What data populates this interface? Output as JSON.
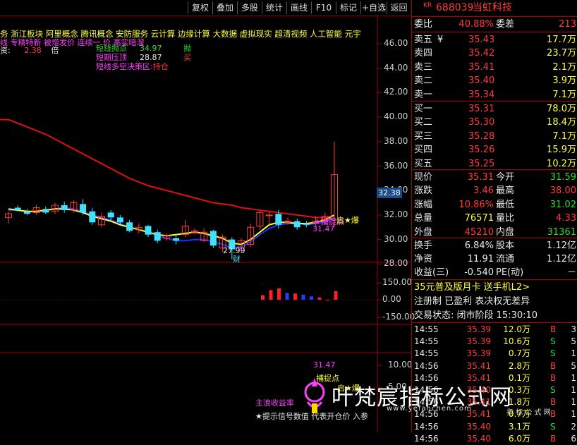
{
  "toolbar": {
    "items": [
      "复权",
      "叠加",
      "多股",
      "统计",
      "画线",
      "F10",
      "标记",
      "+自选",
      "返回"
    ]
  },
  "concepts": "务 浙江板块 阿里概念 腾讯概念 安防服务 云计算 边缘计算 大数据 虚拟现实 超清视频 人工智能 元宇",
  "overlay_lines": {
    "line1": "线 专精特新 被增发价 连续一 价 高实暗溜",
    "line2_left": "资:",
    "line2_val": "2.38",
    "line2_unit": "倍"
  },
  "strategy": {
    "rows": [
      {
        "label": "短线抛点",
        "value": "34.97",
        "signal": "抛"
      },
      {
        "label": "短期压顶",
        "value": "28.87",
        "signal": "买"
      }
    ],
    "zone_label": "短线多空决策区:",
    "zone_value": "持仓"
  },
  "price_axis": {
    "ticks": [
      "46.00",
      "44.00",
      "42.00",
      "40.00",
      "38.00",
      "36.00",
      "34.00",
      "32.00",
      "30.00",
      "28.00"
    ],
    "current": "32.38"
  },
  "volume_axis": {
    "ticks": [
      "150.00",
      "0.00",
      "-150.00"
    ]
  },
  "lower_axis": {
    "ticks": [
      "10.00",
      "5.00"
    ]
  },
  "chart_annotations": {
    "low": "27.99",
    "low_label": "财",
    "buy_label": "★捕捉点",
    "buy_value": "31.47",
    "boom_label": "启★爆",
    "lower_value": "31.47",
    "lower_buy": "捕捉点",
    "lower_boom": "启★爆"
  },
  "lower_texts": {
    "main": "主浪收益率",
    "hint": "★提示信号数值 代表开仓价 入参"
  },
  "watermark": {
    "name": "叶梵宸指标公式网",
    "url": "www.yefanchen.com",
    "url_cn": "指 标 公 式 网"
  },
  "quote": {
    "code_prefix": "KR",
    "code": "688039",
    "name": "当虹科技",
    "weibi_label": "委比",
    "weibi": "40.88%",
    "weicha_label": "委差",
    "weicha": "213",
    "sell": [
      {
        "label": "卖五",
        "mark": "¥",
        "price": "35.43",
        "vol": "17.7万"
      },
      {
        "label": "卖四",
        "price": "35.42",
        "vol": "23.7万"
      },
      {
        "label": "卖三",
        "price": "35.41",
        "vol": "2.1万"
      },
      {
        "label": "卖二",
        "price": "35.40",
        "vol": "3.9万"
      },
      {
        "label": "卖一",
        "price": "35.34",
        "vol": "7.1万"
      }
    ],
    "buy": [
      {
        "label": "买一",
        "price": "35.31",
        "vol": "78.0万"
      },
      {
        "label": "买二",
        "price": "35.30",
        "vol": "18.4万"
      },
      {
        "label": "买三",
        "price": "35.28",
        "vol": "7.1万"
      },
      {
        "label": "买四",
        "price": "35.26",
        "vol": "15.9万"
      },
      {
        "label": "买五",
        "price": "35.25",
        "vol": "10.2万"
      }
    ],
    "stats": [
      {
        "l1": "现价",
        "v1": "35.31",
        "l2": "今开",
        "v2": "31.59"
      },
      {
        "l1": "涨跌",
        "v1": "3.46",
        "l2": "最高",
        "v2": "38.00"
      },
      {
        "l1": "涨幅",
        "v1": "10.86%",
        "l2": "最低",
        "v2": "31.02"
      },
      {
        "l1": "总量",
        "v1": "76571",
        "l2": "量比",
        "v2": "4.33"
      },
      {
        "l1": "外盘",
        "v1": "45210",
        "l2": "内盘",
        "v2": "31361"
      }
    ],
    "stats2": [
      {
        "l1": "换手",
        "v1": "6.84%",
        "l2": "股本",
        "v2": "1.12亿"
      },
      {
        "l1": "净资",
        "v1": "11.91",
        "l2": "流通",
        "v2": "1.12亿"
      },
      {
        "l1": "收益(三)",
        "v1": "-0.540",
        "l2": "PE(动)",
        "v2": "－"
      }
    ],
    "promo": "35元普及版月卡 送手机L2>",
    "register": "注册制 已盈利 表决权无差异",
    "status": "交易状态: 闭市阶段 15:30:10",
    "trades": [
      {
        "t": "14:55",
        "p": "35.39",
        "v": "12.0万",
        "s": "B",
        "n": "3"
      },
      {
        "t": "14:55",
        "p": "35.39",
        "v": "10.6万",
        "s": "S",
        "n": "5"
      },
      {
        "t": "14:55",
        "p": "35.39",
        "v": "0.7万",
        "s": "S",
        "n": "1"
      },
      {
        "t": "14:56",
        "p": "35.41",
        "v": "2.8万",
        "s": "B",
        "n": "5"
      },
      {
        "t": "14:56",
        "p": "35.41",
        "v": "0.1万",
        "s": "B",
        "n": "1"
      },
      {
        "t": "14:56",
        "p": "35.40",
        "v": "0.3万",
        "s": "S",
        "n": "1"
      },
      {
        "t": "14:56",
        "p": "35.41",
        "v": "1.8万",
        "s": "B",
        "n": "1"
      },
      {
        "t": "14:56",
        "p": "35.41",
        "v": "0.7万",
        "s": "B",
        "n": "1"
      },
      {
        "t": "14:56",
        "p": "35.40",
        "v": "3.1万",
        "s": "S",
        "n": "2"
      },
      {
        "t": "14:56",
        "p": "35.40",
        "v": "6.0万",
        "s": "B",
        "n": "6"
      }
    ]
  },
  "chart_data": {
    "type": "candlestick",
    "ylim": [
      27,
      47
    ],
    "candles": [
      [
        31.8,
        32.1,
        31.3,
        32.3
      ],
      [
        32.6,
        32.4,
        32.3,
        32.8
      ],
      [
        32.3,
        32.1,
        32.0,
        32.5
      ],
      [
        32.2,
        32.6,
        32.0,
        32.8
      ],
      [
        32.5,
        32.2,
        32.1,
        32.7
      ],
      [
        32.3,
        32.8,
        32.1,
        33.0
      ],
      [
        32.8,
        32.4,
        32.2,
        33.1
      ],
      [
        32.4,
        33.0,
        32.2,
        33.2
      ],
      [
        32.9,
        32.2,
        32.0,
        33.3
      ],
      [
        32.3,
        31.4,
        31.2,
        32.6
      ],
      [
        31.2,
        31.9,
        31.0,
        32.2
      ],
      [
        32.2,
        31.8,
        31.5,
        32.4
      ],
      [
        31.8,
        31.4,
        31.2,
        32.0
      ],
      [
        31.4,
        30.7,
        30.6,
        31.6
      ],
      [
        30.8,
        31.0,
        30.5,
        31.3
      ],
      [
        31.1,
        30.4,
        30.2,
        31.2
      ],
      [
        30.6,
        29.9,
        29.7,
        30.8
      ],
      [
        30.1,
        30.3,
        29.9,
        30.5
      ],
      [
        30.1,
        29.9,
        29.6,
        30.4
      ],
      [
        30.4,
        31.1,
        30.2,
        31.6
      ],
      [
        30.6,
        30.7,
        30.4,
        30.9
      ],
      [
        29.9,
        30.6,
        29.8,
        30.9
      ],
      [
        30.7,
        29.5,
        29.3,
        30.8
      ],
      [
        29.3,
        30.2,
        29.0,
        30.4
      ],
      [
        30.0,
        29.2,
        28.4,
        30.2
      ],
      [
        29.3,
        29.9,
        28.9,
        30.1
      ],
      [
        29.6,
        31.0,
        29.4,
        31.3
      ],
      [
        31.1,
        32.2,
        30.8,
        32.3
      ],
      [
        32.0,
        32.0,
        31.2,
        32.3
      ],
      [
        32.1,
        31.2,
        30.9,
        32.4
      ],
      [
        31.4,
        31.5,
        31.2,
        31.8
      ],
      [
        31.5,
        31.0,
        30.8,
        31.7
      ],
      [
        31.3,
        31.2,
        31.0,
        31.5
      ],
      [
        31.4,
        31.5,
        31.0,
        31.9
      ],
      [
        31.6,
        31.9,
        31.2,
        32.2
      ],
      [
        31.6,
        35.3,
        31.0,
        38.0
      ]
    ],
    "ma_red": [
      39.8,
      39.5,
      39.2,
      38.9,
      38.6,
      38.2,
      37.8,
      37.4,
      37.0,
      36.6,
      36.2,
      35.8,
      35.4,
      35.0,
      34.7,
      34.4,
      34.2,
      34.0,
      33.8,
      33.6,
      33.4,
      33.2,
      33.0,
      32.9,
      32.8,
      32.6,
      32.5,
      32.4,
      32.3,
      32.2,
      32.1,
      32.0,
      31.9,
      31.8,
      31.8,
      31.7
    ],
    "ma_yellow": [
      32.5,
      32.4,
      32.3,
      32.3,
      32.4,
      32.5,
      32.5,
      32.4,
      32.2,
      31.9,
      31.7,
      31.5,
      31.2,
      31.0,
      30.8,
      30.6,
      30.4,
      30.3,
      30.4,
      30.5,
      30.6,
      30.5,
      30.3,
      30.1,
      29.7,
      29.6,
      30.0,
      30.6,
      31.2,
      31.4,
      31.4,
      31.3,
      31.3,
      31.4,
      31.6,
      32.0
    ],
    "ma_blue": [
      32.4,
      32.4,
      32.3,
      32.3,
      32.4,
      32.5,
      32.6,
      32.5,
      32.3,
      32.0,
      31.8,
      31.6,
      31.3,
      31.0,
      30.8,
      30.6,
      30.3,
      30.1,
      29.9,
      29.9,
      30.0,
      30.0,
      29.8,
      29.6,
      29.3,
      29.4,
      29.8,
      30.4,
      30.9,
      31.2,
      31.3,
      31.3,
      31.2,
      31.3,
      31.4,
      31.8
    ],
    "vol_ylim": [
      -150,
      150
    ],
    "vol_bars": [
      {
        "v": 40,
        "c": "red"
      },
      {
        "v": 85,
        "c": "red"
      },
      {
        "v": 100,
        "c": "red"
      },
      {
        "v": 60,
        "c": "blue"
      },
      {
        "v": 55,
        "c": "red"
      },
      {
        "v": 45,
        "c": "blue"
      },
      {
        "v": 30,
        "c": "blue"
      },
      {
        "v": 20,
        "c": "red"
      },
      {
        "v": 0,
        "c": "red"
      },
      {
        "v": 75,
        "c": "red"
      }
    ]
  },
  "colors": {
    "up": "#ff3b3b",
    "down": "#40e0ff",
    "ma_red": "#e01010",
    "ma_yellow": "#ffff30",
    "ma_blue": "#2030ff",
    "grid": "#800000"
  }
}
